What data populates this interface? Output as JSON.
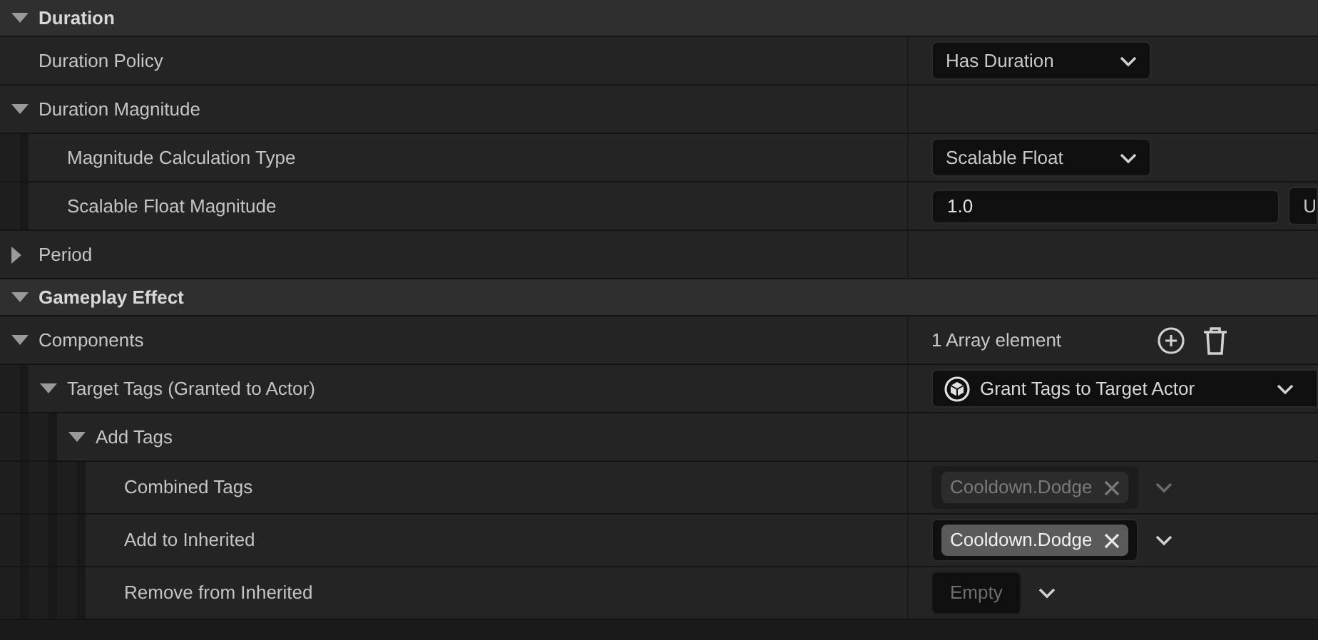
{
  "rows": [
    {
      "kind": "category",
      "label": "Duration",
      "expanded": true,
      "children": [
        {
          "kind": "property",
          "label": "Duration Policy",
          "value": {
            "kind": "combo",
            "text": "Has Duration"
          }
        },
        {
          "kind": "property",
          "label": "Duration Magnitude",
          "expanded": true,
          "children": [
            {
              "kind": "property",
              "label": "Magnitude Calculation Type",
              "value": {
                "kind": "combo",
                "text": "Scalable Float"
              }
            },
            {
              "kind": "property",
              "label": "Scalable Float Magnitude",
              "value": {
                "kind": "number",
                "text": "1.0",
                "extra": "U"
              }
            }
          ]
        },
        {
          "kind": "property",
          "label": "Period",
          "expanded": false
        }
      ]
    },
    {
      "kind": "category",
      "label": "Gameplay Effect",
      "expanded": true,
      "children": [
        {
          "kind": "property",
          "label": "Components",
          "expanded": true,
          "value": {
            "kind": "array",
            "text": "1 Array element"
          },
          "children": [
            {
              "kind": "property",
              "label": "Target Tags (Granted to Actor)",
              "expanded": true,
              "value": {
                "kind": "class",
                "text": "Grant Tags to Target Actor"
              },
              "children": [
                {
                  "kind": "property",
                  "label": "Add Tags",
                  "expanded": true,
                  "children": [
                    {
                      "kind": "property",
                      "label": "Combined Tags",
                      "value": {
                        "kind": "tags",
                        "disabled": true,
                        "tags": [
                          "Cooldown.Dodge"
                        ]
                      }
                    },
                    {
                      "kind": "property",
                      "label": "Add to Inherited",
                      "value": {
                        "kind": "tags",
                        "disabled": false,
                        "tags": [
                          "Cooldown.Dodge"
                        ]
                      }
                    },
                    {
                      "kind": "property",
                      "label": "Remove from Inherited",
                      "value": {
                        "kind": "empty",
                        "text": "Empty"
                      }
                    }
                  ]
                }
              ]
            }
          ]
        }
      ]
    }
  ]
}
